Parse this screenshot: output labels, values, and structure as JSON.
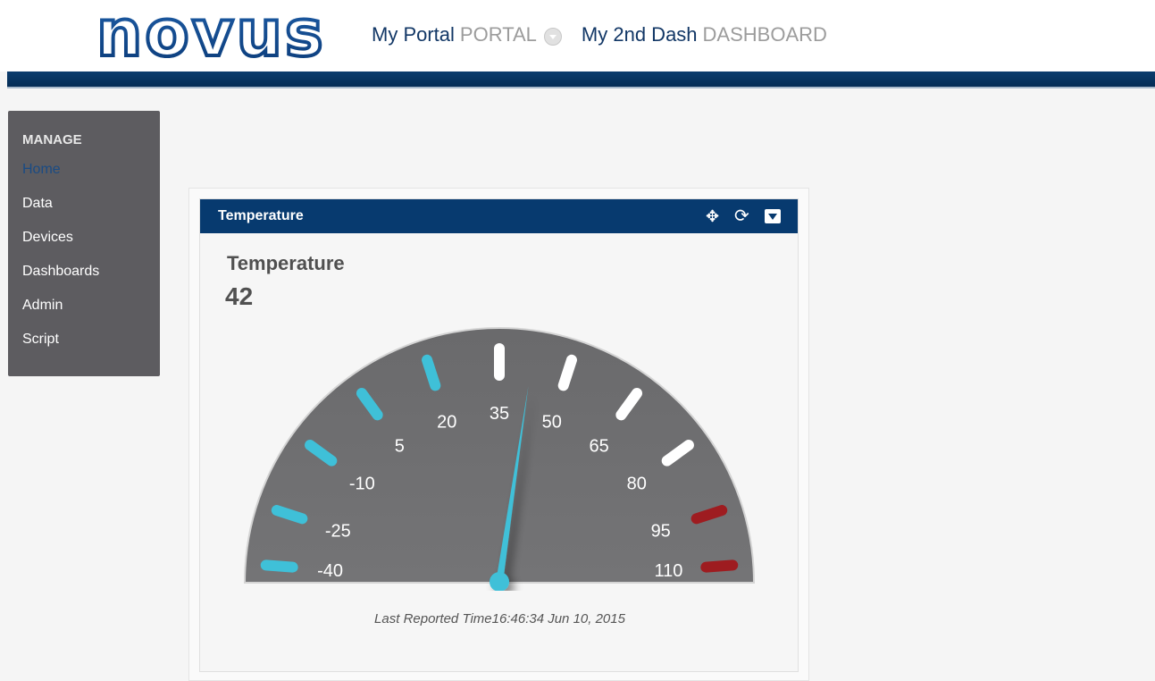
{
  "header": {
    "logo_text": "novus",
    "portal_name": "My Portal",
    "portal_label": "PORTAL",
    "dashboard_name": "My 2nd Dash",
    "dashboard_label": "DASHBOARD"
  },
  "sidebar": {
    "heading": "MANAGE",
    "items": [
      {
        "label": "Home",
        "active": true
      },
      {
        "label": "Data"
      },
      {
        "label": "Devices"
      },
      {
        "label": "Dashboards"
      },
      {
        "label": "Admin"
      },
      {
        "label": "Script"
      }
    ]
  },
  "widget": {
    "title": "Temperature",
    "icons": [
      "move-icon",
      "refresh-icon",
      "collapse-icon"
    ],
    "tile_label": "Temperature",
    "value": "42",
    "last_reported_label": "Last Reported Time",
    "last_reported_time": "16:46:34 Jun 10, 2015"
  },
  "chart_data": {
    "type": "gauge",
    "min": -40,
    "max": 110,
    "value": 42,
    "ticks": [
      "-40",
      "-25",
      "-10",
      "5",
      "20",
      "35",
      "50",
      "65",
      "80",
      "95",
      "110"
    ],
    "zones": [
      {
        "from": -40,
        "to": 20,
        "color": "#3fc0d8"
      },
      {
        "from": 35,
        "to": 80,
        "color": "#ffffff"
      },
      {
        "from": 95,
        "to": 110,
        "color": "#9e1c20"
      }
    ],
    "needle_color": "#3fc0d8",
    "face_color": "#707072"
  },
  "colors": {
    "brand_blue": "#073a6f",
    "sidebar_bg": "#5d5c60"
  }
}
